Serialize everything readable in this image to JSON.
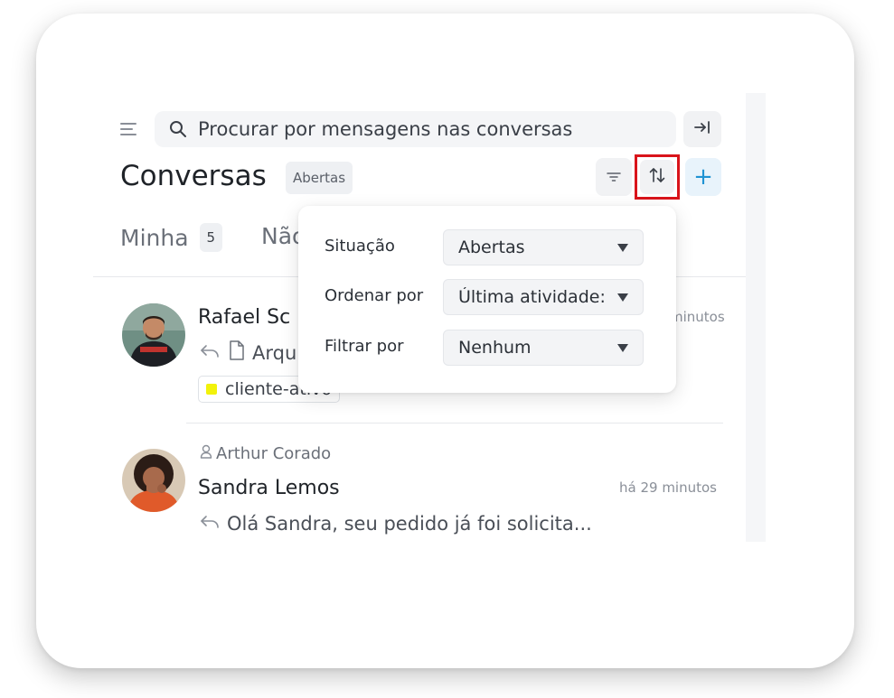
{
  "search": {
    "placeholder": "Procurar por mensagens nas conversas"
  },
  "header": {
    "title": "Conversas",
    "status_chip": "Abertas",
    "add_label": "+"
  },
  "tabs": [
    {
      "label": "Minha",
      "count": "5"
    },
    {
      "label": "Não"
    }
  ],
  "conversations": [
    {
      "name": "Rafael Sc",
      "time": "minutos",
      "preview": "Arqu",
      "label": {
        "text": "cliente-ativo",
        "color": "#f2f20a"
      }
    },
    {
      "assignee": "Arthur Corado",
      "name": "Sandra Lemos",
      "time": "há 29 minutos",
      "preview": "Olá Sandra, seu pedido já foi solicita..."
    }
  ],
  "sort_menu": {
    "rows": [
      {
        "label": "Situação",
        "value": "Abertas"
      },
      {
        "label": "Ordenar por",
        "value": "Última atividade:"
      },
      {
        "label": "Filtrar por",
        "value": "Nenhum"
      }
    ]
  },
  "colors": {
    "accent": "#1f93d3",
    "highlight_border": "#d9141b",
    "label_yellow": "#f2f20a"
  },
  "icons": [
    "menu-icon",
    "search-icon",
    "dock-right-icon",
    "filter-icon",
    "sort-icon",
    "plus-icon",
    "reply-icon",
    "file-icon",
    "user-icon",
    "caret-down-icon"
  ]
}
